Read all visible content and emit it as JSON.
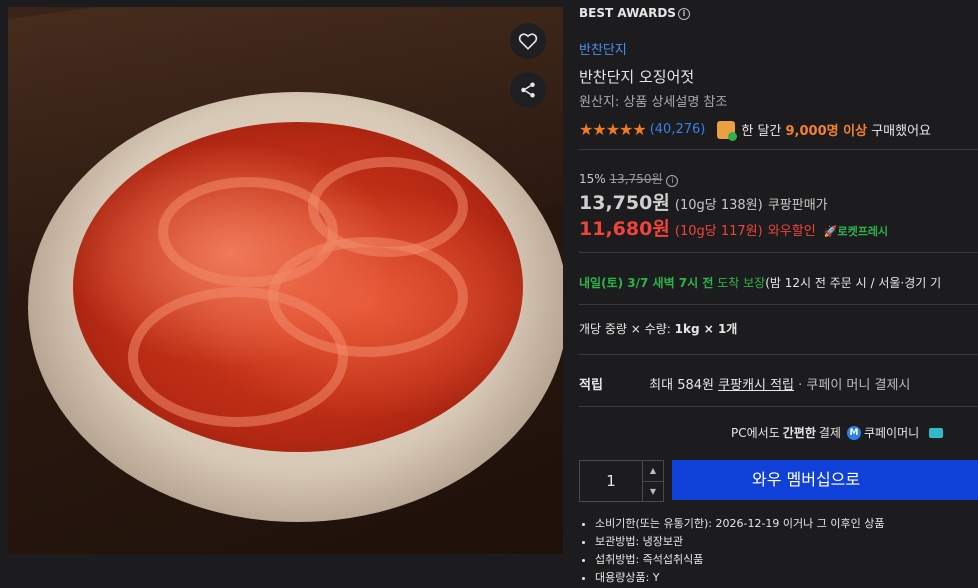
{
  "photo": {
    "alt": "반찬단지 오징어젓"
  },
  "award": {
    "label": "BEST AWARDS",
    "info": "i"
  },
  "product": {
    "brand": "반찬단지",
    "title": "반찬단지 오징어젓",
    "origin": "원산지: 상품 상세설명 참조",
    "rating_stars": "★★★★★",
    "rating_value": 4.5,
    "review_count": "(40,276)",
    "buy_prefix": "한 달간",
    "buy_highlight": "9,000명 이상",
    "buy_suffix": "구매했어요"
  },
  "price": {
    "discount_rate": "15%",
    "original": "13,750원",
    "sale_price": "13,750원",
    "sale_unit": "(10g당 138원)",
    "sale_label": "쿠팡판매가",
    "wow_price": "11,680원",
    "wow_unit": "(10g당 117원)",
    "wow_label": "와우할인",
    "rocket_label": "로켓프레시"
  },
  "delivery": {
    "date": "내일(토) 3/7 새벽 7시 전",
    "guarantee": "도착 보장",
    "note": "(밤 12시 전 주문 시 / 서울·경기 기"
  },
  "option": {
    "text": "개당 중량 × 수량:",
    "value": "1kg × 1개"
  },
  "points": {
    "label": "적립",
    "max": "최대 584원",
    "link": "쿠팡캐시 적립",
    "note": "· 쿠페이 머니 결제시"
  },
  "pc_pay": {
    "prefix": "PC에서도",
    "bold": "간편한",
    "suffix": "결제",
    "money": "쿠페이머니",
    "mark": "M"
  },
  "purchase": {
    "quantity": "1",
    "button": "와우 멤버십으로"
  },
  "specs": [
    "소비기한(또는 유통기한): 2026-12-19 이거나 그 이후인 상품",
    "보관방법: 냉장보관",
    "섭취방법: 즉석섭취식품",
    "대용량상품: Y"
  ]
}
